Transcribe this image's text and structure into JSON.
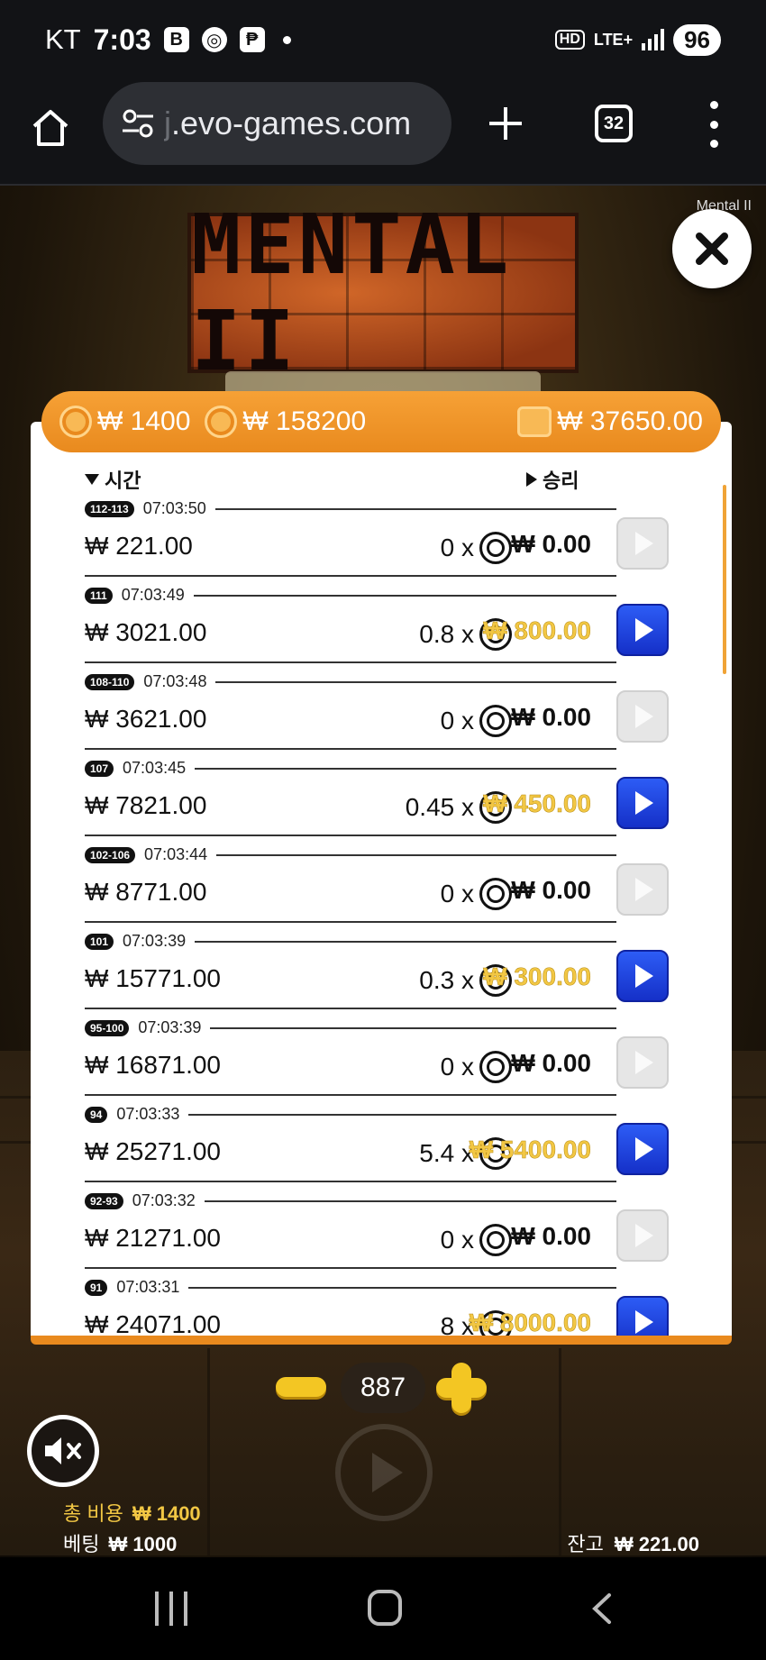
{
  "status_bar": {
    "carrier": "KT",
    "time": "7:03",
    "app_icons": [
      "B",
      "chrome-icon",
      "pay-icon"
    ],
    "hd": "HD",
    "network": "LTE+",
    "battery": "96"
  },
  "browser": {
    "url_prefix": "j",
    "url": ".evo-games.com",
    "tab_count": "32"
  },
  "game": {
    "window_title": "Mental II",
    "logo_text": "MENTAL II",
    "header": {
      "coin_cost": "₩ 1400",
      "coin_total": "₩ 158200",
      "wallet_balance": "₩ 37650.00"
    },
    "columns": {
      "time": "시간",
      "win": "승리"
    },
    "rows": [
      {
        "badge": "112-113",
        "time": "07:03:50",
        "balance": "₩ 221.00",
        "mult": "0 x",
        "win": "₩ 0.00",
        "gold": false
      },
      {
        "badge": "111",
        "time": "07:03:49",
        "balance": "₩ 3021.00",
        "mult": "0.8 x",
        "win": "₩ 800.00",
        "gold": true
      },
      {
        "badge": "108-110",
        "time": "07:03:48",
        "balance": "₩ 3621.00",
        "mult": "0 x",
        "win": "₩ 0.00",
        "gold": false
      },
      {
        "badge": "107",
        "time": "07:03:45",
        "balance": "₩ 7821.00",
        "mult": "0.45 x",
        "win": "₩ 450.00",
        "gold": true
      },
      {
        "badge": "102-106",
        "time": "07:03:44",
        "balance": "₩ 8771.00",
        "mult": "0 x",
        "win": "₩ 0.00",
        "gold": false
      },
      {
        "badge": "101",
        "time": "07:03:39",
        "balance": "₩ 15771.00",
        "mult": "0.3 x",
        "win": "₩ 300.00",
        "gold": true
      },
      {
        "badge": "95-100",
        "time": "07:03:39",
        "balance": "₩ 16871.00",
        "mult": "0 x",
        "win": "₩ 0.00",
        "gold": false
      },
      {
        "badge": "94",
        "time": "07:03:33",
        "balance": "₩ 25271.00",
        "mult": "5.4 x",
        "win": "₩ 5400.00",
        "gold": true
      },
      {
        "badge": "92-93",
        "time": "07:03:32",
        "balance": "₩ 21271.00",
        "mult": "0 x",
        "win": "₩ 0.00",
        "gold": false
      },
      {
        "badge": "91",
        "time": "07:03:31",
        "balance": "₩ 24071.00",
        "mult": "8 x",
        "win": "₩ 8000.00",
        "gold": true
      }
    ],
    "stepper_value": "887",
    "total_cost_label": "총 비용",
    "total_cost_value": "₩ 1400",
    "bet_label": "베팅",
    "bet_value": "₩ 1000",
    "balance_label": "잔고",
    "balance_value": "₩ 221.00"
  },
  "colors": {
    "accent_orange": "#e98a1e",
    "win_gold": "#f2c744",
    "play_blue": "#1f44e0"
  }
}
